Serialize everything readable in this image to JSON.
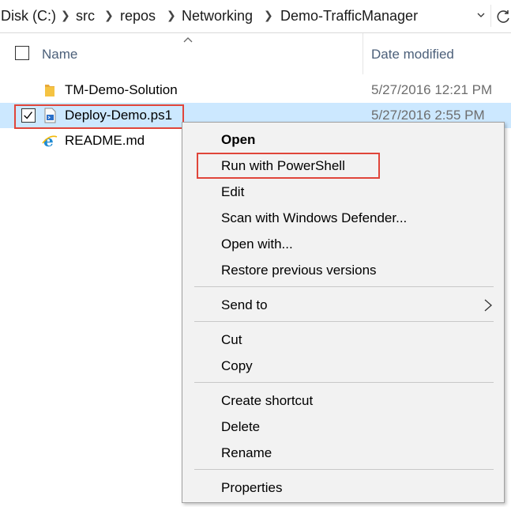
{
  "breadcrumb": {
    "items": [
      "Disk (C:)",
      "src",
      "repos",
      "Networking",
      "Demo-TrafficManager"
    ],
    "separator_icon": "chevron-right-icon",
    "dropdown_icon": "chevron-down-icon",
    "refresh_icon": "refresh-icon"
  },
  "columns": {
    "name": "Name",
    "date_modified": "Date modified",
    "sort_icon": "sort-ascending-caret-icon"
  },
  "files": [
    {
      "name": "TM-Demo-Solution",
      "date": "5/27/2016 12:21 PM",
      "icon": "folder-icon",
      "selected": false
    },
    {
      "name": "Deploy-Demo.ps1",
      "date": "5/27/2016 2:55 PM",
      "icon": "powershell-script-icon",
      "selected": true,
      "checked": true
    },
    {
      "name": "README.md",
      "date": "",
      "icon": "internet-explorer-icon",
      "selected": false
    }
  ],
  "context_menu": {
    "items": [
      {
        "label": "Open",
        "bold": true
      },
      {
        "label": "Run with PowerShell",
        "highlighted": true
      },
      {
        "label": "Edit"
      },
      {
        "label": "Scan with Windows Defender..."
      },
      {
        "label": "Open with..."
      },
      {
        "label": "Restore previous versions"
      },
      {
        "label": "Send to",
        "submenu": true
      },
      {
        "label": "Cut"
      },
      {
        "label": "Copy"
      },
      {
        "label": "Create shortcut"
      },
      {
        "label": "Delete"
      },
      {
        "label": "Rename"
      },
      {
        "label": "Properties"
      }
    ]
  },
  "colors": {
    "selection_bg": "#cce8ff",
    "highlight_border": "#e0453a",
    "menu_bg": "#f2f2f2",
    "header_text": "#4c607a",
    "folder": "#f5c342",
    "ie_blue": "#1f8ad2"
  }
}
